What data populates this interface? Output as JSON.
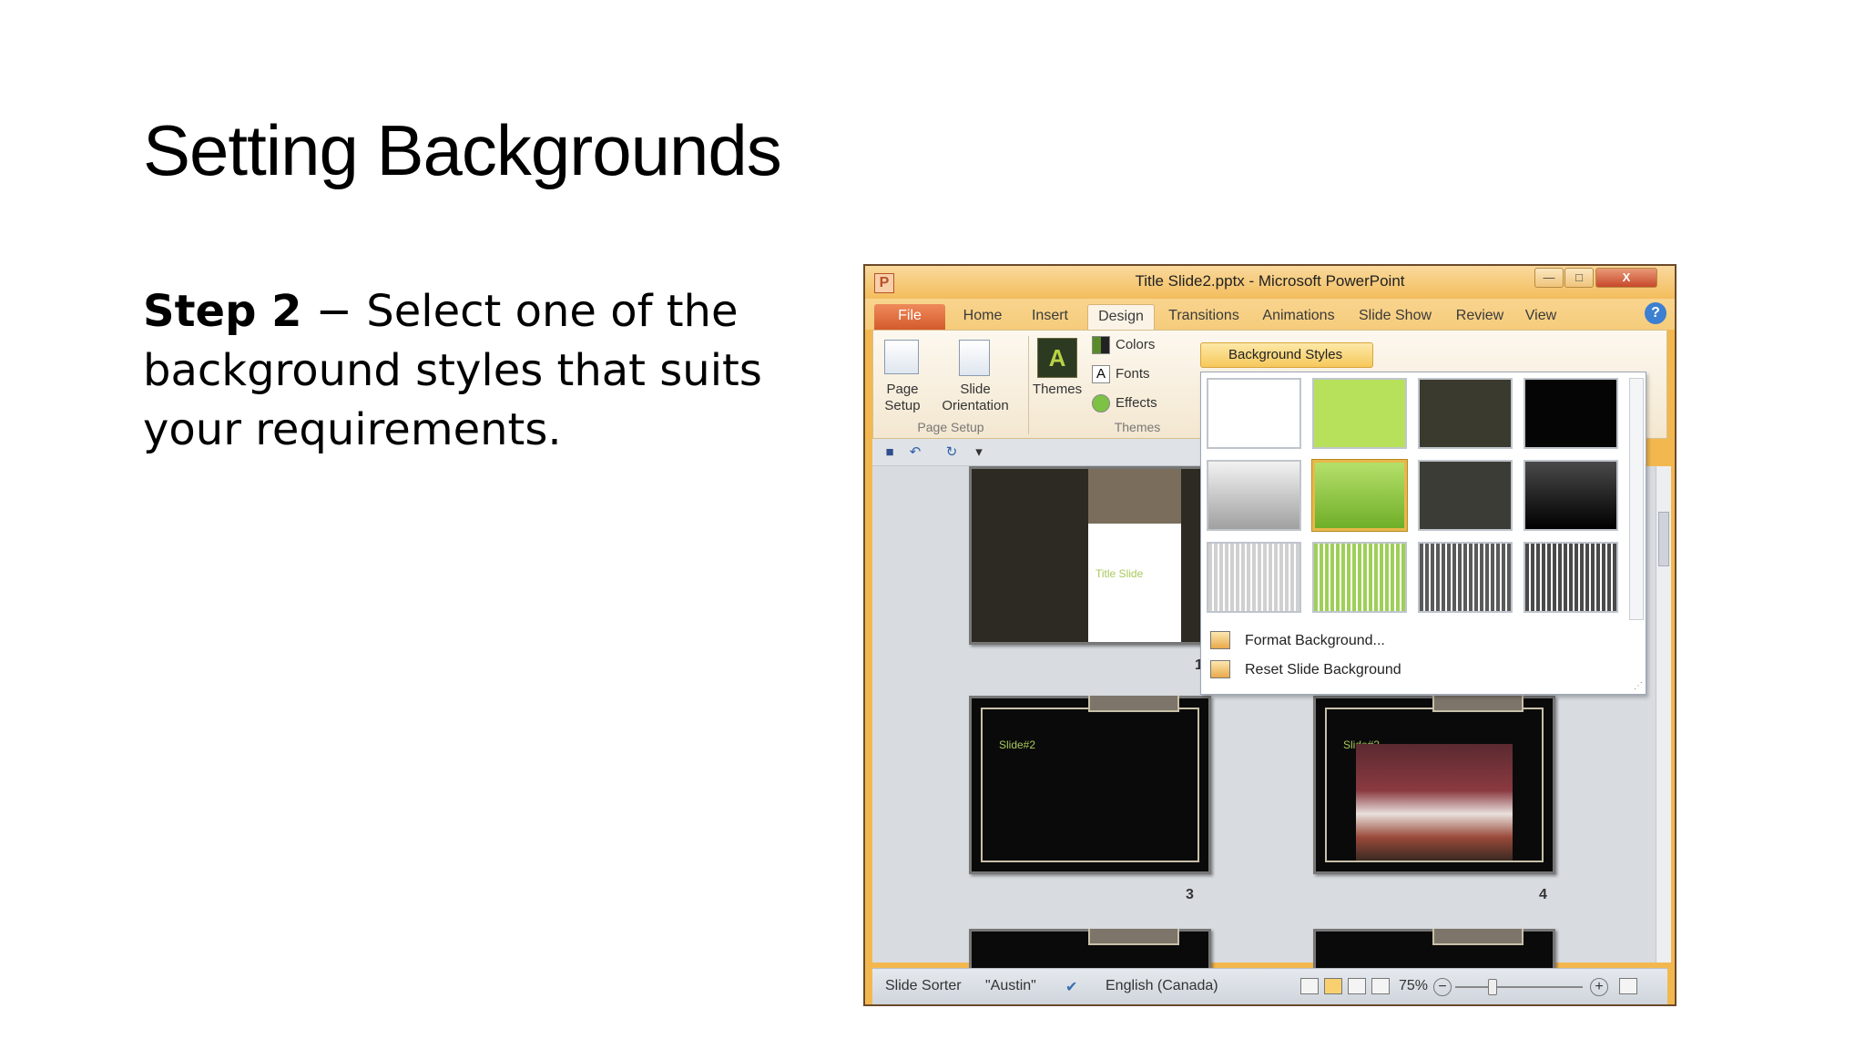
{
  "slide": {
    "title": "Setting Backgrounds",
    "step_label": "Step 2",
    "step_text": " − Select one of the background styles that suits your requirements."
  },
  "window": {
    "app_icon": "P",
    "title": "Title Slide2.pptx - Microsoft PowerPoint",
    "controls": {
      "minimize": "—",
      "maximize": "□",
      "close": "X"
    }
  },
  "tabs": [
    "File",
    "Home",
    "Insert",
    "Design",
    "Transitions",
    "Animations",
    "Slide Show",
    "Review",
    "View"
  ],
  "active_tab": "Design",
  "ribbon": {
    "page_setup": "Page Setup",
    "slide_orientation": "Slide Orientation",
    "group_page_setup": "Page Setup",
    "themes": "Themes",
    "group_themes": "Themes",
    "colors": "Colors",
    "fonts": "Fonts",
    "effects": "Effects",
    "background_styles": "Background Styles"
  },
  "gallery": {
    "swatches": [
      {
        "style": "white",
        "color": "#ffffff"
      },
      {
        "style": "light-green",
        "color": "#b7e15a"
      },
      {
        "style": "dark-olive",
        "color": "#3a3a2e"
      },
      {
        "style": "black",
        "color": "#050505"
      },
      {
        "style": "gray-gradient",
        "color": "#b8b8b8"
      },
      {
        "style": "green-gradient",
        "color": "#8cc63a",
        "selected": true
      },
      {
        "style": "dark-gray",
        "color": "#3c3c36"
      },
      {
        "style": "black-gradient",
        "color": "#1c1c1c"
      },
      {
        "style": "light-stripes",
        "color": "#d0d0d0"
      },
      {
        "style": "green-stripes",
        "color": "#9fcf58"
      },
      {
        "style": "dark-stripes",
        "color": "#5a5a5a"
      },
      {
        "style": "charcoal-stripes",
        "color": "#4a4a4a"
      }
    ],
    "menu": [
      "Format Background...",
      "Reset Slide Background"
    ]
  },
  "thumbnails": [
    {
      "num": "1",
      "caption": "Title Slide"
    },
    {
      "num": "3",
      "caption": "Slide#2"
    },
    {
      "num": "4",
      "caption": "Slide#3"
    }
  ],
  "statusbar": {
    "view": "Slide Sorter",
    "theme": "\"Austin\"",
    "language": "English (Canada)",
    "zoom": "75%"
  },
  "colors": {
    "accent": "#f2b84f",
    "file_tab": "#d45a2c"
  }
}
